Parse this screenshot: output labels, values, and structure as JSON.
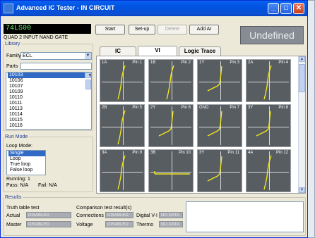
{
  "window": {
    "title": "Advanced IC Tester - IN CIRCUIT"
  },
  "device": {
    "name": "74LS00",
    "description": "QUAD 2 INPUT NAND GATE"
  },
  "toolbar": {
    "start": "Start",
    "setup": "Set-up",
    "delete": "Delete",
    "add_ai": "Add AI"
  },
  "status": {
    "text": "Undefined"
  },
  "library": {
    "legend": "Library",
    "family_label": "Family:",
    "family_value": "ECL",
    "parts_label": "Parts",
    "parts": [
      "10103",
      "10106",
      "10107",
      "10109",
      "10110",
      "10111",
      "10113",
      "10114",
      "10115",
      "10116",
      "10117"
    ],
    "selected_index": 0
  },
  "run_mode": {
    "legend": "Run Mode",
    "loop_mode_label": "Loop Mode:",
    "modes": [
      "Single",
      "Loop",
      "True loop",
      "False loop"
    ],
    "selected_index": 0,
    "running_label": "Running: 1",
    "pass_label": "Pass: N/A",
    "fail_label": "Fail: N/A"
  },
  "tabs": [
    "IC",
    "VI",
    "Logic Trace"
  ],
  "active_tab": 1,
  "vi_cells": [
    {
      "name": "1A",
      "pin": "Pin 1",
      "curve": "steep"
    },
    {
      "name": "1B",
      "pin": "Pin 2",
      "curve": "steep"
    },
    {
      "name": "1Y",
      "pin": "Pin 3",
      "curve": "knee"
    },
    {
      "name": "2A",
      "pin": "Pin 4",
      "curve": "steep"
    },
    {
      "name": "2B",
      "pin": "Pin 5",
      "curve": "steep"
    },
    {
      "name": "2Y",
      "pin": "Pin 6",
      "curve": "knee"
    },
    {
      "name": "GND",
      "pin": "Pin 7",
      "curve": "knee"
    },
    {
      "name": "3Y",
      "pin": "Pin 8",
      "curve": "knee"
    },
    {
      "name": "3A",
      "pin": "Pin 9",
      "curve": "steep"
    },
    {
      "name": "3B",
      "pin": "Pin 10",
      "curve": "flat"
    },
    {
      "name": "3Y",
      "pin": "Pin 11",
      "curve": "knee"
    },
    {
      "name": "4A",
      "pin": "Pin 12",
      "curve": "steep"
    }
  ],
  "results": {
    "legend": "Results",
    "truth_table_label": "Truth table test",
    "comparison_label": "Comparison test result(s)",
    "actual_label": "Actual",
    "actual_value": "DISABLED",
    "master_label": "Master",
    "master_value": "DISABLED",
    "connections_label": "Connections",
    "connections_value": "DISABLED",
    "voltage_label": "Voltage",
    "voltage_value": "DISABLED",
    "digital_vi_label": "Digital V-I",
    "digital_vi_value": "NO DATA",
    "thermo_label": "Thermo",
    "thermo_value": "NO DATA"
  },
  "colors": {
    "titlebar": "#0153e0",
    "trace": "#f2e61e",
    "cell_bg": "#585d62",
    "device_text": "#6cf06c",
    "selection": "#316ac5"
  }
}
